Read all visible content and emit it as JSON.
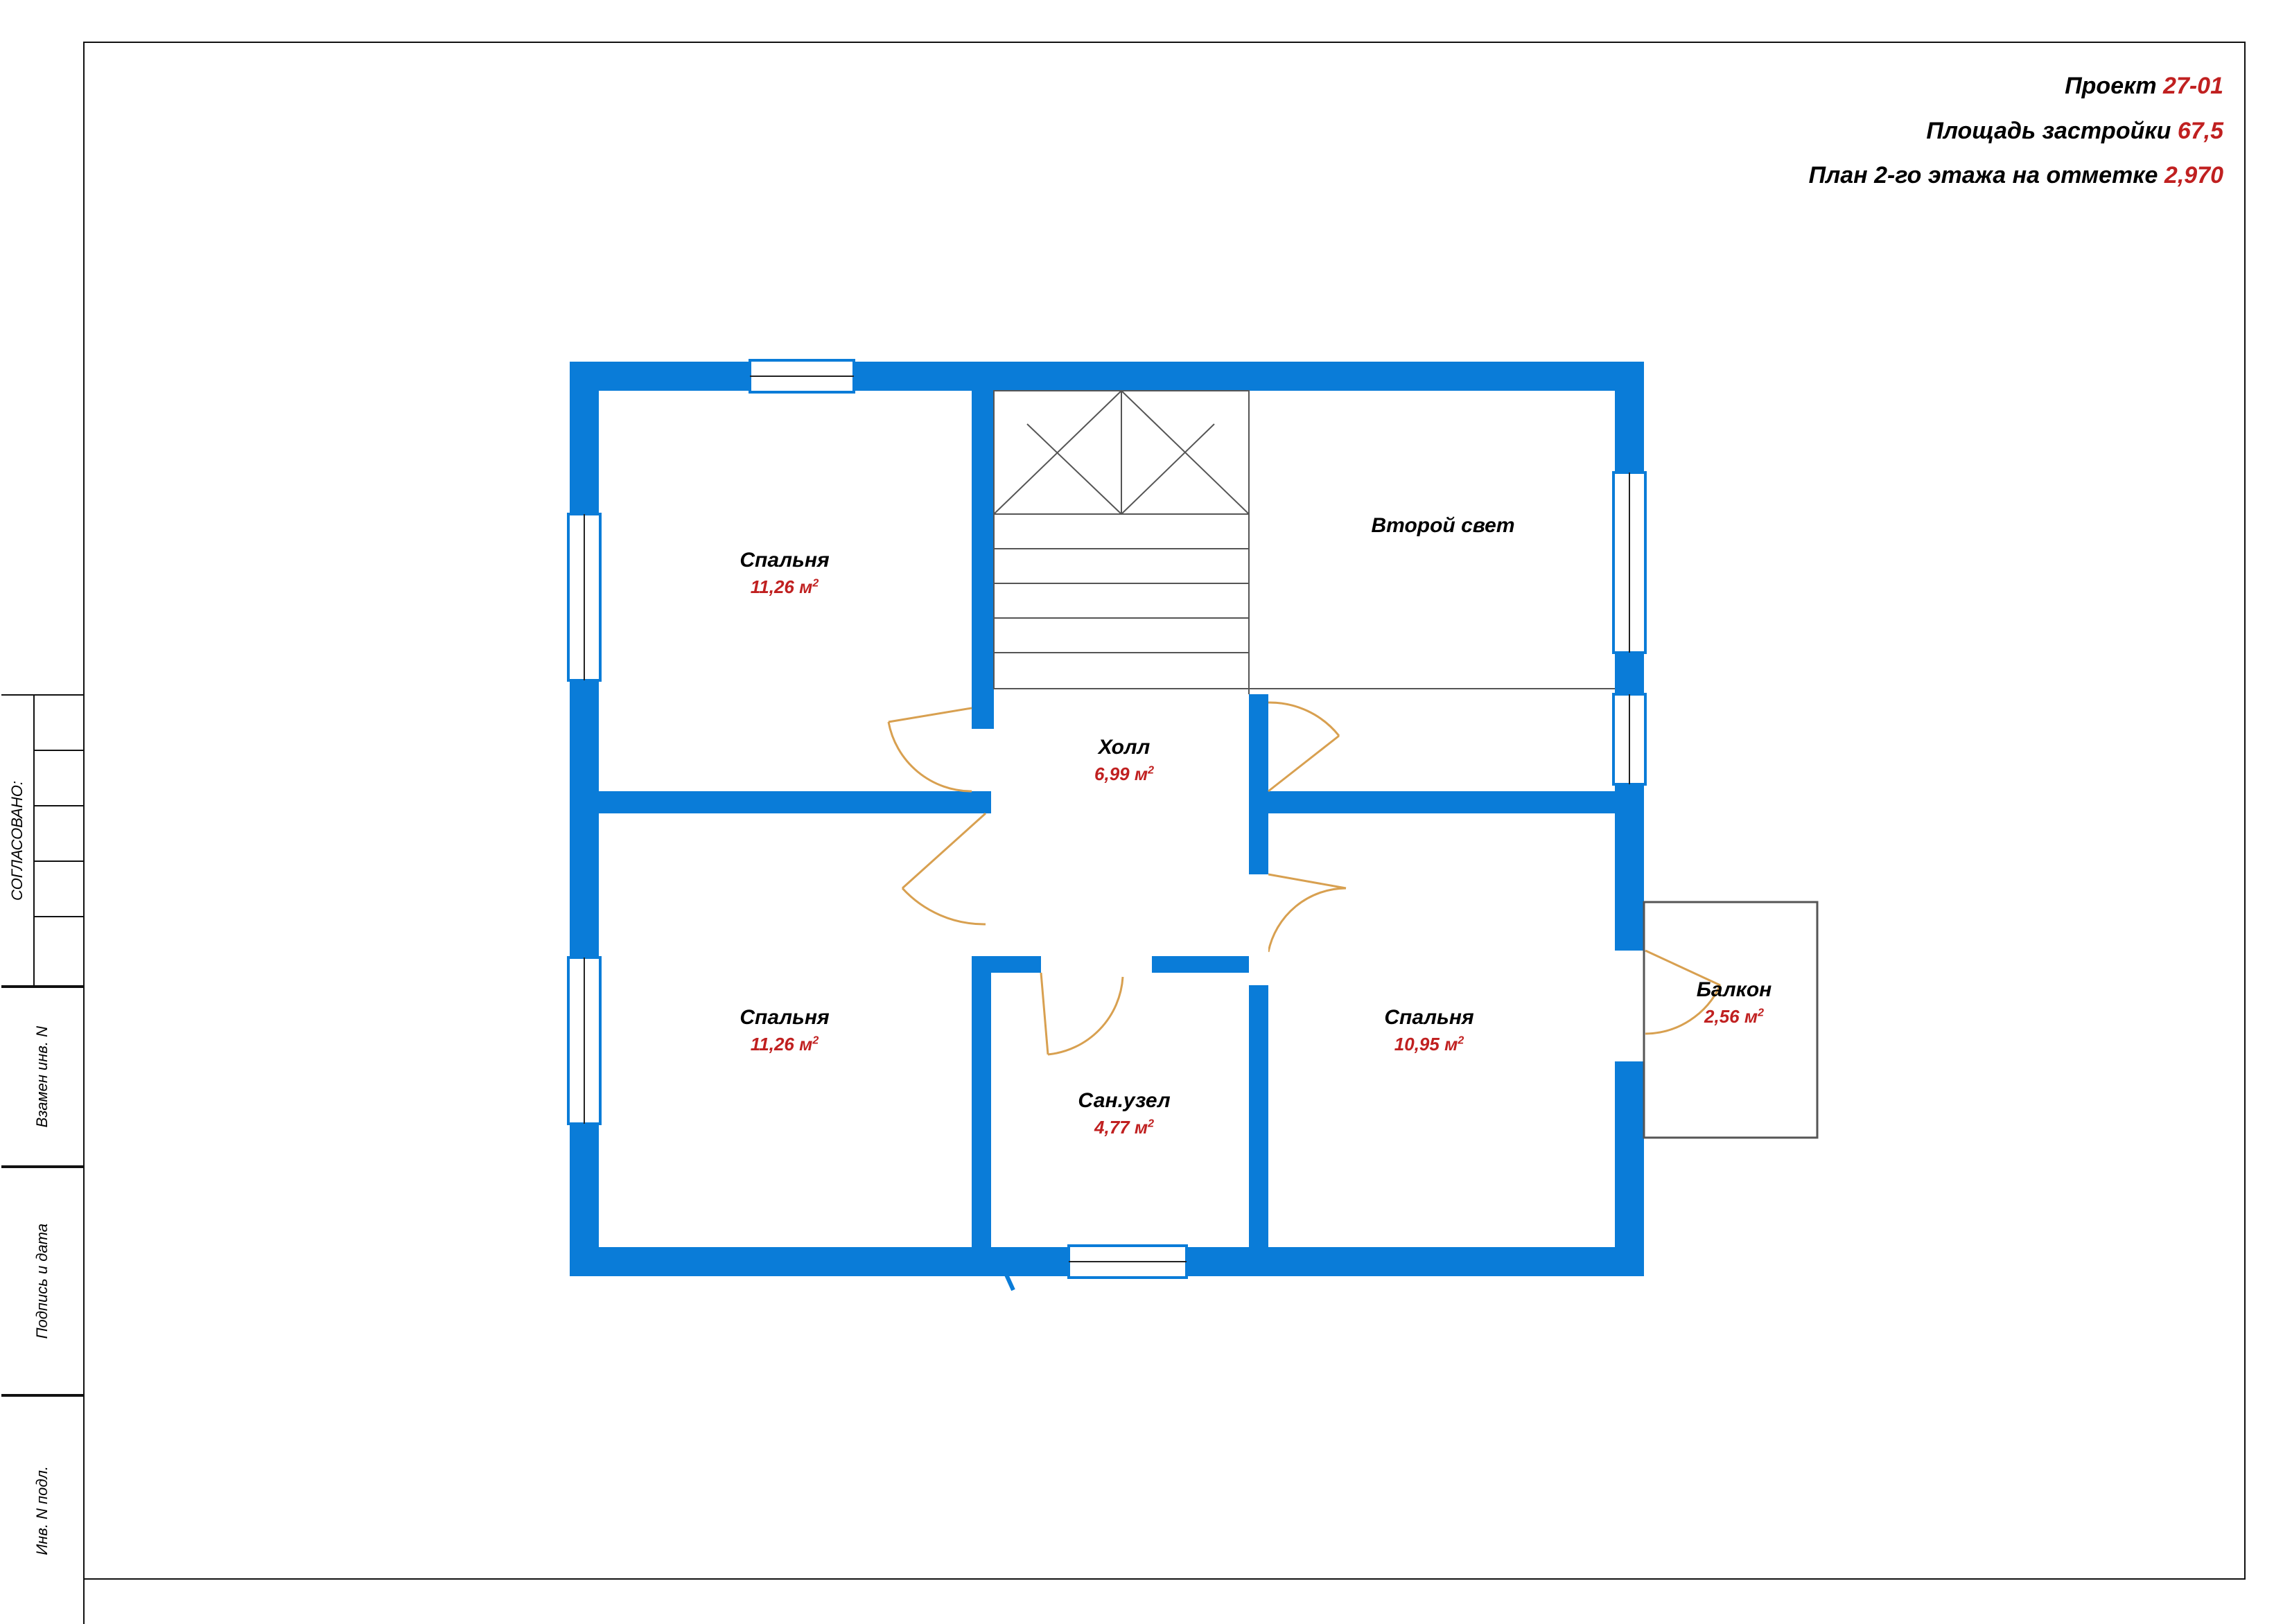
{
  "header": {
    "project_label": "Проект",
    "project_value": "27-01",
    "area_label": "Площадь застройки",
    "area_value": "67,5",
    "plan_label": "План 2-го этажа на отметке",
    "plan_value": "2,970"
  },
  "sidebar": {
    "soglasovano": "СОГЛАСОВАНО:",
    "vzamen": "Взамен инв. N",
    "podpis": "Подпись и дата",
    "inv": "Инв. N подл."
  },
  "rooms": {
    "bedroom_top_left": {
      "name": "Спальня",
      "area": "11,26 м"
    },
    "bedroom_bottom_left": {
      "name": "Спальня",
      "area": "11,26 м"
    },
    "bedroom_bottom_right": {
      "name": "Спальня",
      "area": "10,95 м"
    },
    "hall": {
      "name": "Холл",
      "area": "6,99 м"
    },
    "bathroom": {
      "name": "Сан.узел",
      "area": "4,77 м"
    },
    "second_light": {
      "name": "Второй свет",
      "area": ""
    },
    "balcony": {
      "name": "Балкон",
      "area": "2,56 м"
    }
  },
  "colors": {
    "wall": "#0a7cd8",
    "value": "#c02020",
    "door": "#d8a050"
  }
}
